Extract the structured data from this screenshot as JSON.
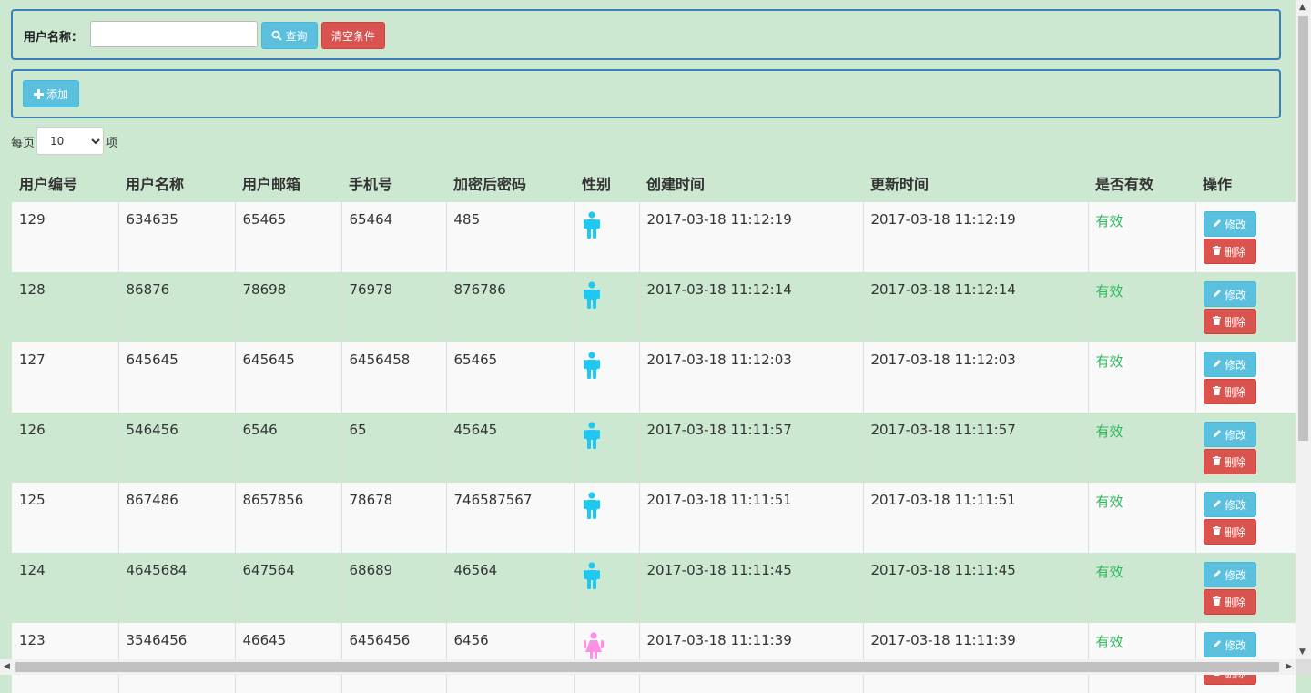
{
  "search": {
    "label": "用户名称：",
    "input_value": "",
    "input_placeholder": "",
    "query_label": "查询",
    "clear_label": "清空条件"
  },
  "toolbar": {
    "add_label": "添加"
  },
  "pagination": {
    "prefix": "每页",
    "page_size": "10",
    "suffix": "项"
  },
  "table": {
    "headers": [
      "用户编号",
      "用户名称",
      "用户邮箱",
      "手机号",
      "加密后密码",
      "性别",
      "创建时间",
      "更新时间",
      "是否有效",
      "操作"
    ],
    "edit_label": "修改",
    "delete_label": "删除",
    "rows": [
      {
        "id": "129",
        "name": "634635",
        "email": "65465",
        "phone": "65464",
        "password": "485",
        "gender": "male",
        "created": "2017-03-18 11:12:19",
        "updated": "2017-03-18 11:12:19",
        "status": "有效"
      },
      {
        "id": "128",
        "name": "86876",
        "email": "78698",
        "phone": "76978",
        "password": "876786",
        "gender": "male",
        "created": "2017-03-18 11:12:14",
        "updated": "2017-03-18 11:12:14",
        "status": "有效"
      },
      {
        "id": "127",
        "name": "645645",
        "email": "645645",
        "phone": "6456458",
        "password": "65465",
        "gender": "male",
        "created": "2017-03-18 11:12:03",
        "updated": "2017-03-18 11:12:03",
        "status": "有效"
      },
      {
        "id": "126",
        "name": "546456",
        "email": "6546",
        "phone": "65",
        "password": "45645",
        "gender": "male",
        "created": "2017-03-18 11:11:57",
        "updated": "2017-03-18 11:11:57",
        "status": "有效"
      },
      {
        "id": "125",
        "name": "867486",
        "email": "8657856",
        "phone": "78678",
        "password": "746587567",
        "gender": "male",
        "created": "2017-03-18 11:11:51",
        "updated": "2017-03-18 11:11:51",
        "status": "有效"
      },
      {
        "id": "124",
        "name": "4645684",
        "email": "647564",
        "phone": "68689",
        "password": "46564",
        "gender": "male",
        "created": "2017-03-18 11:11:45",
        "updated": "2017-03-18 11:11:45",
        "status": "有效"
      },
      {
        "id": "123",
        "name": "3546456",
        "email": "46645",
        "phone": "6456456",
        "password": "6456",
        "gender": "female",
        "created": "2017-03-18 11:11:39",
        "updated": "2017-03-18 11:11:39",
        "status": "有效"
      }
    ]
  },
  "colors": {
    "page_bg": "#cde8d1",
    "info": "#5bc0de",
    "danger": "#d9534f",
    "valid_text": "#2eb85c",
    "male_icon": "#1ec8f0",
    "female_icon": "#ff8ee6"
  },
  "icons": {
    "query": "search-icon",
    "add": "plus-icon",
    "edit": "pencil-icon",
    "delete": "trash-icon",
    "male": "male-icon",
    "female": "female-icon"
  }
}
